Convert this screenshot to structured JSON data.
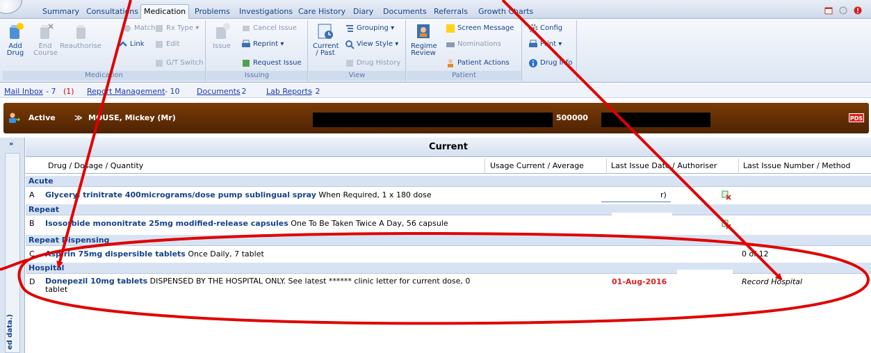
{
  "tabs": [
    {
      "label": "Summary"
    },
    {
      "label": "Consultations"
    },
    {
      "label": "Medication"
    },
    {
      "label": "Problems"
    },
    {
      "label": "Investigations"
    },
    {
      "label": "Care History"
    },
    {
      "label": "Diary"
    },
    {
      "label": "Documents"
    },
    {
      "label": "Referrals"
    },
    {
      "label": "Growth Charts"
    }
  ],
  "ribbon": {
    "medication": {
      "label": "Medication",
      "add_drug": "Add",
      "add_drug_2": "Drug",
      "end_course": "End",
      "end_course_2": "Course",
      "reauthorise": "Reauthorise",
      "match": "Match",
      "link": "Link",
      "rx_type": "Rx Type",
      "edit": "Edit",
      "gt_switch": "G/T Switch"
    },
    "issuing": {
      "label": "Issuing",
      "issue": "Issue",
      "cancel_issue": "Cancel Issue",
      "reprint": "Reprint",
      "request_issue": "Request Issue"
    },
    "view": {
      "label": "View",
      "current_past": "Current",
      "current_past_2": "/ Past",
      "grouping": "Grouping",
      "view_style": "View Style",
      "drug_history": "Drug History"
    },
    "patient": {
      "label": "Patient",
      "regime_review": "Regime",
      "regime_review_2": "Review",
      "screen_message": "Screen Message",
      "nominations": "Nominations",
      "patient_actions": "Patient Actions"
    },
    "tools": {
      "config": "Config",
      "print": "Print",
      "drug_info": "Drug Info"
    }
  },
  "infobar": {
    "mail_inbox": "Mail Inbox",
    "mail_count": "- 7",
    "mail_unread": "(1)",
    "report_management": "Report Management",
    "report_count": "- 10",
    "documents": "Documents",
    "documents_count": "- 2",
    "lab_reports": "Lab Reports",
    "lab_count": "- 2"
  },
  "patient": {
    "status": "Active",
    "name": "MOUSE, Mickey (Mr)",
    "number": "500000",
    "pds": "PDS"
  },
  "side_text": "ed data.)",
  "table": {
    "title": "Current",
    "columns": [
      "Drug / Dosage / Quantity",
      "Usage Current / Average",
      "Last Issue Date / Authoriser",
      "Last Issue Number / Method"
    ],
    "sections": [
      {
        "name": "Acute",
        "rows": [
          {
            "letter": "A",
            "drug": "Glyceryl trinitrate 400micrograms/dose pump sublingual spray",
            "dosage": " When Required, 1 x 180 dose",
            "authoriser_fragment": "r)"
          }
        ]
      },
      {
        "name": "Repeat",
        "rows": [
          {
            "letter": "B",
            "drug": "Isosorbide mononitrate 25mg modified-release capsules",
            "dosage": " One To Be Taken Twice A Day, 56 capsule"
          }
        ]
      },
      {
        "name": "Repeat Dispensing",
        "rows": [
          {
            "letter": "C",
            "drug": "Aspirin 75mg dispersible tablets",
            "dosage": " Once Daily, 7 tablet",
            "issue_number": "0 of 12"
          }
        ]
      },
      {
        "name": "Hospital",
        "rows": [
          {
            "letter": "D",
            "drug": "Donepezil 10mg tablets",
            "dosage": " DISPENSED BY THE HOSPITAL ONLY. See latest ****** clinic letter for current dose, 0 tablet",
            "last_issue_date": "01-Aug-2016",
            "method": "Record Hospital"
          }
        ]
      }
    ]
  },
  "colors": {
    "banner": "#6b3205",
    "annotation": "#e00000",
    "link": "#1a3aa8",
    "hospital_date": "#e02020"
  }
}
